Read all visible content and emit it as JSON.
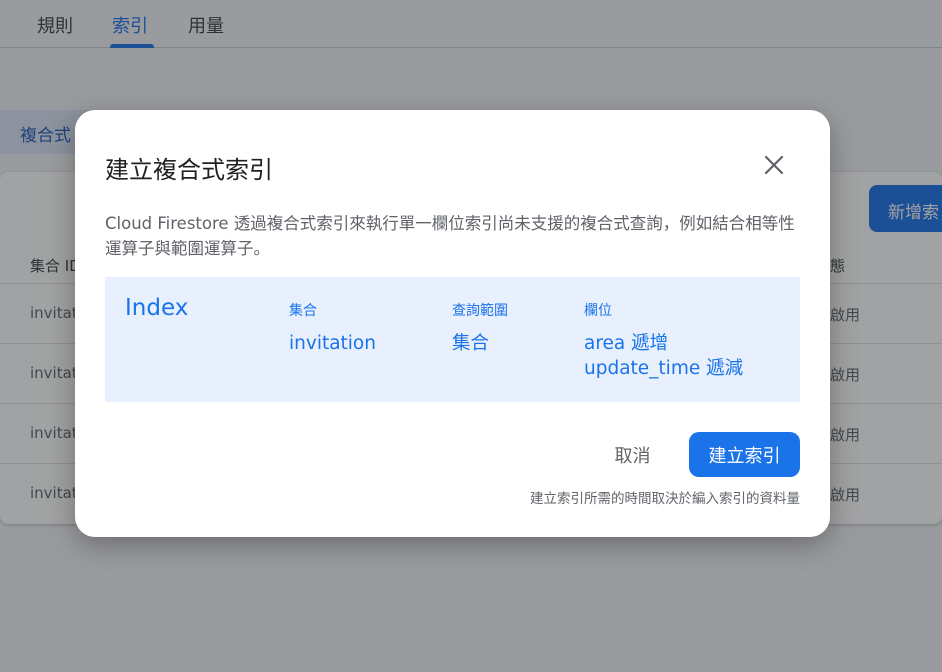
{
  "tabs": [
    {
      "label": "規則"
    },
    {
      "label": "索引"
    },
    {
      "label": "用量"
    }
  ],
  "filter_chip": {
    "label": "複合式"
  },
  "table": {
    "new_button_label": "新增索",
    "headers": {
      "collection": "集合 ID",
      "state": "態"
    },
    "rows": [
      {
        "collection": "invitat",
        "state": "啟用"
      },
      {
        "collection": "invitat",
        "state": "啟用"
      },
      {
        "collection": "invitat",
        "state": "啟用"
      },
      {
        "collection": "invitat",
        "state": "啟用"
      }
    ]
  },
  "dialog": {
    "title": "建立複合式索引",
    "description": "Cloud Firestore 透過複合式索引來執行單一欄位索引尚未支援的複合式查詢，例如結合相等性運算子與範圍運算子。",
    "index": {
      "title": "Index",
      "headers": {
        "collection": "集合",
        "scope": "查詢範圍",
        "fields": "欄位"
      },
      "collection": "invitation",
      "scope": "集合",
      "fields": [
        "area 遞增",
        "update_time 遞減"
      ]
    },
    "cancel_label": "取消",
    "create_label": "建立索引",
    "footnote": "建立索引所需的時間取決於編入索引的資料量"
  },
  "colors": {
    "accent": "#1a73e8",
    "index_box": "#e8f0fe"
  },
  "icons": {
    "close": "close-icon"
  }
}
